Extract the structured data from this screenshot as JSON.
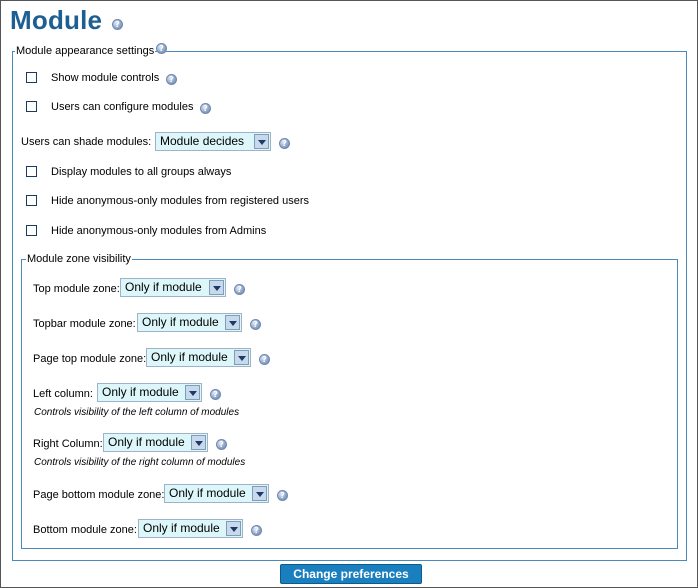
{
  "page": {
    "title": "Module"
  },
  "appearance": {
    "legend": "Module appearance settings",
    "show_controls": "Show module controls",
    "users_configure": "Users can configure modules",
    "shade_label": "Users can shade modules:",
    "shade_value": "Module decides",
    "display_all_groups": "Display modules to all groups always",
    "hide_anon_registered": "Hide anonymous-only modules from registered users",
    "hide_anon_admins": "Hide anonymous-only modules from Admins"
  },
  "zones": {
    "legend": "Module zone visibility",
    "top": {
      "label": "Top module zone:",
      "value": "Only if module"
    },
    "topbar": {
      "label": "Topbar module zone:",
      "value": "Only if module"
    },
    "pagetop": {
      "label": "Page top module zone:",
      "value": "Only if module"
    },
    "left": {
      "label": "Left column:",
      "value": "Only if module",
      "desc": "Controls visibility of the left column of modules"
    },
    "right": {
      "label": "Right Column:",
      "value": "Only if module",
      "desc": "Controls visibility of the right column of modules"
    },
    "pagebottom": {
      "label": "Page bottom module zone:",
      "value": "Only if module"
    },
    "bottom": {
      "label": "Bottom module zone:",
      "value": "Only if module"
    }
  },
  "submit": {
    "label": "Change preferences"
  },
  "help_glyph": "?",
  "colors": {
    "title": "#1d5f93",
    "button": "#1a7fbe",
    "select_bg": "#dcf6f9",
    "border": "#4a89b9"
  }
}
